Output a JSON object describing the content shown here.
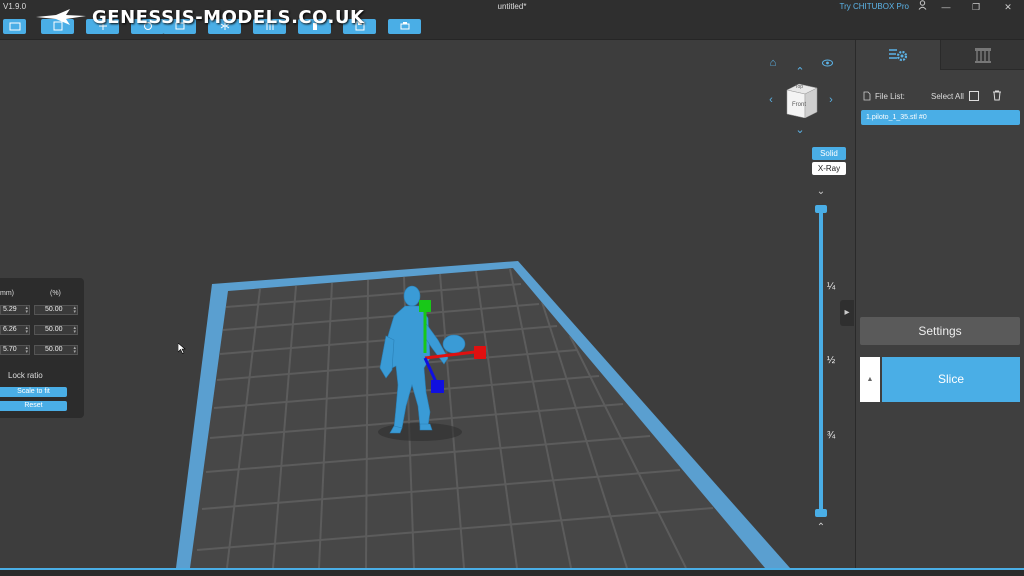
{
  "app": {
    "version": "V1.9.0",
    "document_title": "untitled*",
    "try_pro": "Try CHITUBOX Pro",
    "watermark": "GENESSIS-MODELS.CO.UK"
  },
  "window_controls": {
    "user_icon": "user-icon",
    "minimize_glyph": "—",
    "restore_glyph": "❐",
    "close_glyph": "✕"
  },
  "toolbar": {
    "buttons": [
      "open-icon",
      "add-icon",
      "save-icon",
      "move-icon",
      "rotate-icon",
      "scale-icon",
      "mirror-icon",
      "support-icon",
      "hollow-icon",
      "export-icon",
      "print-icon"
    ]
  },
  "view": {
    "cube_top": "Top",
    "cube_front": "Front",
    "mode_solid": "Solid",
    "mode_xray": "X-Ray"
  },
  "layer_slider": {
    "marks": [
      "¼",
      "½",
      "¾"
    ],
    "top_fraction": 1.0,
    "bottom_fraction": 0.0
  },
  "scale_panel": {
    "unit_mm": "mm)",
    "unit_percent": "(%)",
    "rows": [
      {
        "mm": "5.29",
        "percent": "50.00"
      },
      {
        "mm": "6.26",
        "percent": "50.00"
      },
      {
        "mm": "5.70",
        "percent": "50.00"
      }
    ],
    "lock_ratio": "Lock ratio",
    "scale_to_fit": "Scale to fit",
    "reset": "Reset"
  },
  "right_panel": {
    "file_list_label": "File List:",
    "select_all_label": "Select All",
    "files": [
      "1.piloto_1_35.stl #0"
    ],
    "settings": "Settings",
    "slice": "Slice",
    "slice_arrow": "▲"
  },
  "colors": {
    "accent": "#4aaee6",
    "plate_frame": "#5a9fd0",
    "model": "#3a9bd6",
    "axis_x": "#e01010",
    "axis_y": "#18c818",
    "axis_z": "#1010e0"
  }
}
